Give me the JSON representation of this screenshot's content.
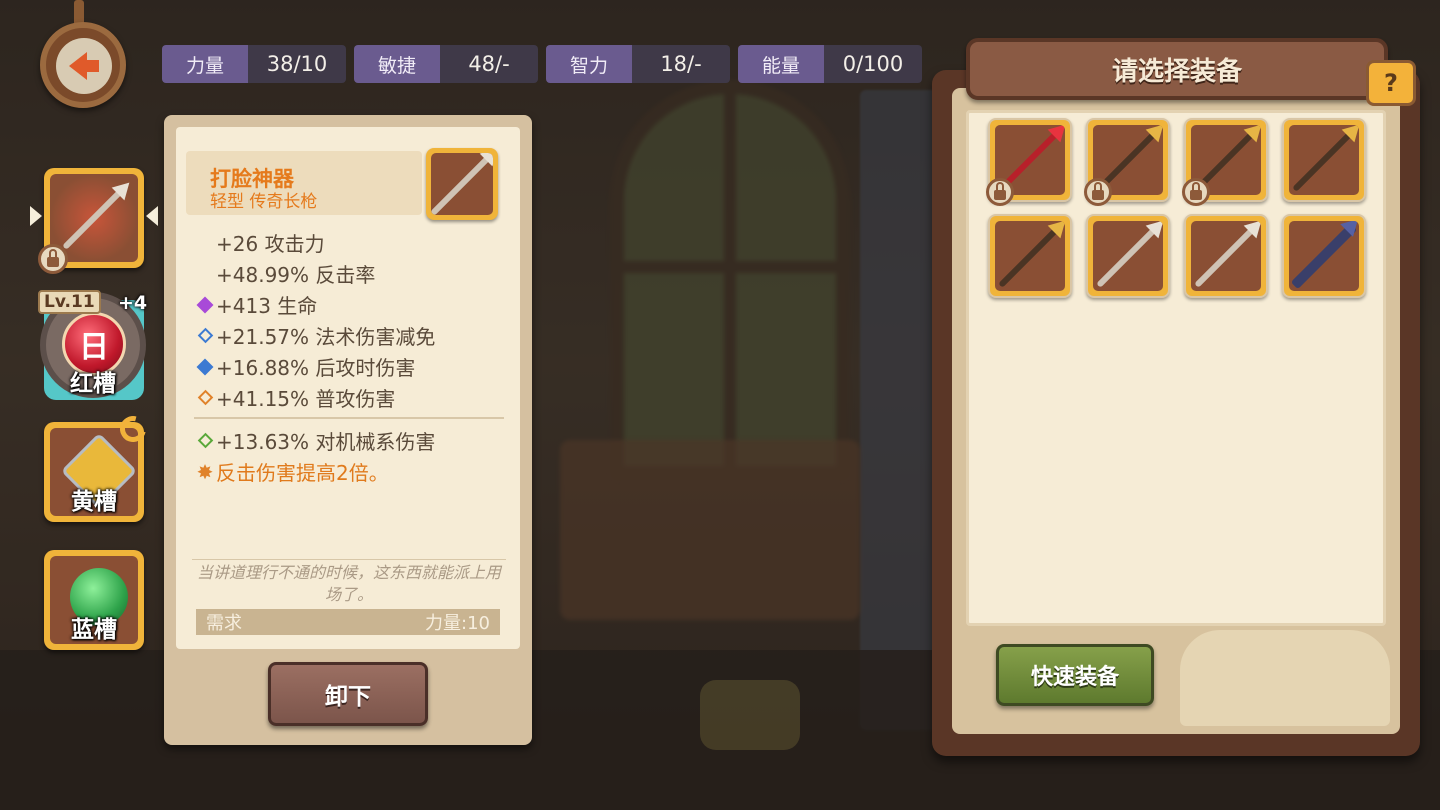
{
  "stats": [
    {
      "label": "力量",
      "value": "38/10"
    },
    {
      "label": "敏捷",
      "value": "48/-"
    },
    {
      "label": "智力",
      "value": "18/-"
    },
    {
      "label": "能量",
      "value": "0/100"
    }
  ],
  "slots": {
    "red": {
      "level": "Lv.11",
      "plus": "+4",
      "label": "红槽",
      "gem_glyph": "日"
    },
    "yellow": {
      "label": "黄槽"
    },
    "blue": {
      "label": "蓝槽"
    }
  },
  "detail": {
    "name": "打脸神器",
    "type": "轻型 传奇长枪",
    "base_stats": [
      "+26 攻击力",
      "+48.99% 反击率"
    ],
    "bonus_stats": [
      {
        "text": "+413 生命",
        "mark": "diamond-purple"
      },
      {
        "text": "+21.57% 法术伤害减免",
        "mark": "diamond-blue-outline"
      },
      {
        "text": "+16.88% 后攻时伤害",
        "mark": "diamond-blue"
      },
      {
        "text": "+41.15% 普攻伤害",
        "mark": "diamond-orange-outline"
      }
    ],
    "extra_stat": {
      "text": "+13.63% 对机械系伤害",
      "mark": "diamond-green-outline"
    },
    "special": {
      "text": "反击伤害提高2倍。",
      "mark": "star-icon"
    },
    "flavor": "当讲道理行不通的时候，这东西就能派上用场了。",
    "requirement": {
      "label": "需求",
      "value": "力量:10"
    },
    "unequip_label": "卸下"
  },
  "chooser": {
    "title": "请选择装备",
    "help_glyph": "?",
    "quick_equip_label": "快速装备",
    "items": [
      {
        "weapon": "red-spear",
        "locked": true
      },
      {
        "weapon": "gold-spear",
        "locked": true
      },
      {
        "weapon": "gold-spear",
        "locked": true
      },
      {
        "weapon": "gold-spear",
        "locked": false
      },
      {
        "weapon": "gold-spear",
        "locked": false
      },
      {
        "weapon": "white-spear",
        "locked": false
      },
      {
        "weapon": "white-spear",
        "locked": false
      },
      {
        "weapon": "blue-cannon",
        "locked": false
      }
    ]
  },
  "colors": {
    "stat_label_bg": "#6a5b8f",
    "item_name": "#e57a1c",
    "slot_frame": "#f0b43a",
    "quick_button": "#86a04a"
  }
}
